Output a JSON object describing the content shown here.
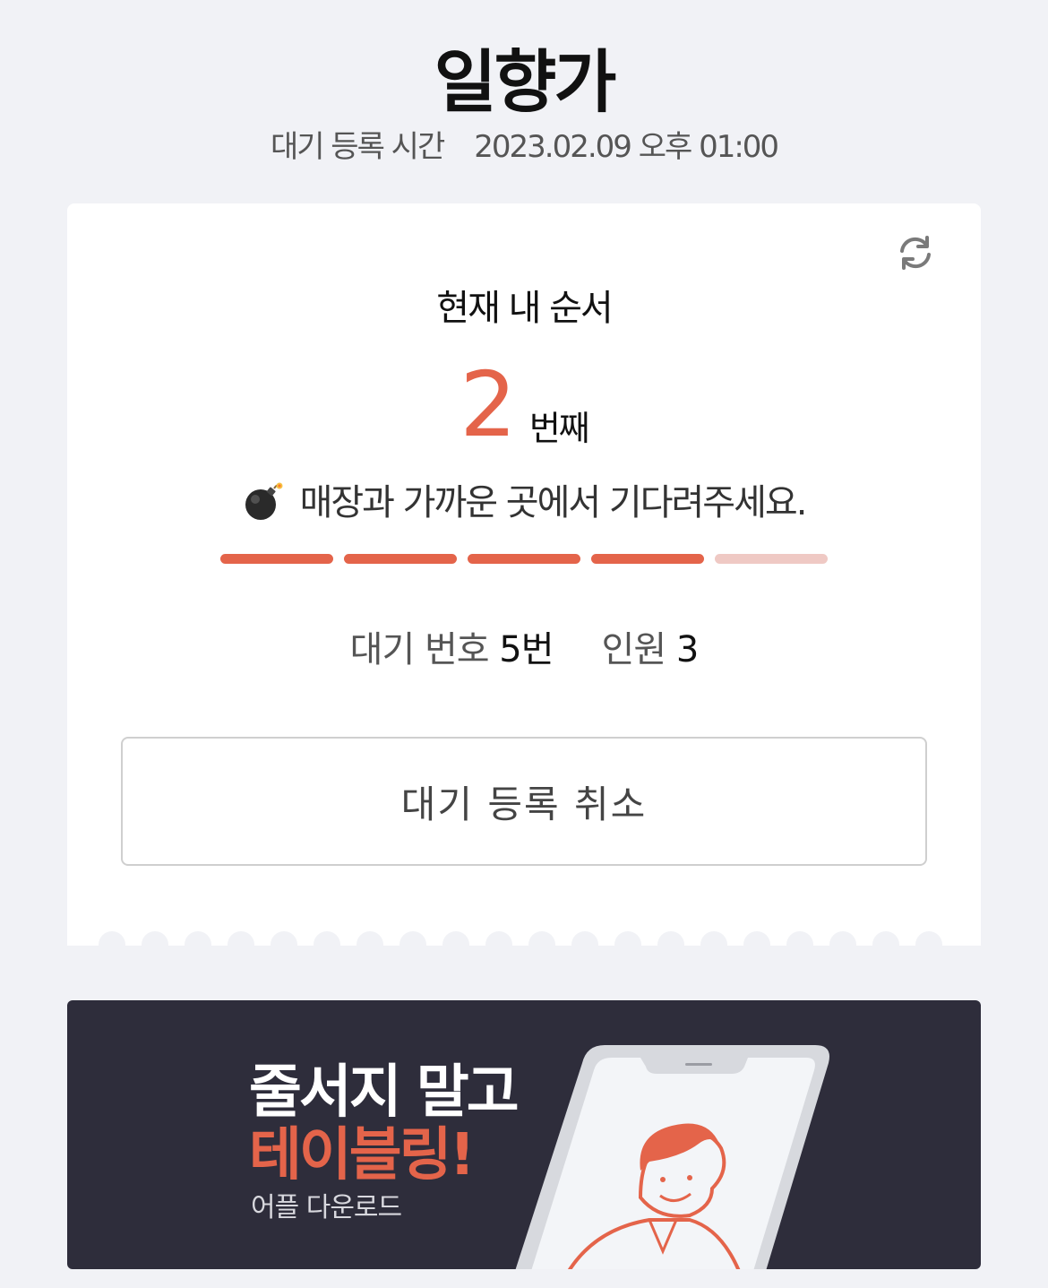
{
  "header": {
    "store_name": "일향가",
    "registered_label": "대기 등록 시간",
    "registered_time": "2023.02.09 오후 01:00"
  },
  "status": {
    "order_label": "현재 내 순서",
    "position": "2",
    "position_unit": "번째",
    "notice_icon": "bomb-emoji",
    "notice_text": "매장과 가까운 곳에서 기다려주세요.",
    "progress": {
      "filled_steps": 4,
      "total_steps": 5
    },
    "accent_color": "#e4644a"
  },
  "details": {
    "queue_label": "대기 번호",
    "queue_value": "5번",
    "party_label": "인원",
    "party_value": "3"
  },
  "actions": {
    "refresh_icon": "refresh-icon",
    "cancel_label": "대기 등록 취소"
  },
  "banner": {
    "line1": "줄서지 말고",
    "line2": "테이블링!",
    "line3": "어플 다운로드"
  }
}
